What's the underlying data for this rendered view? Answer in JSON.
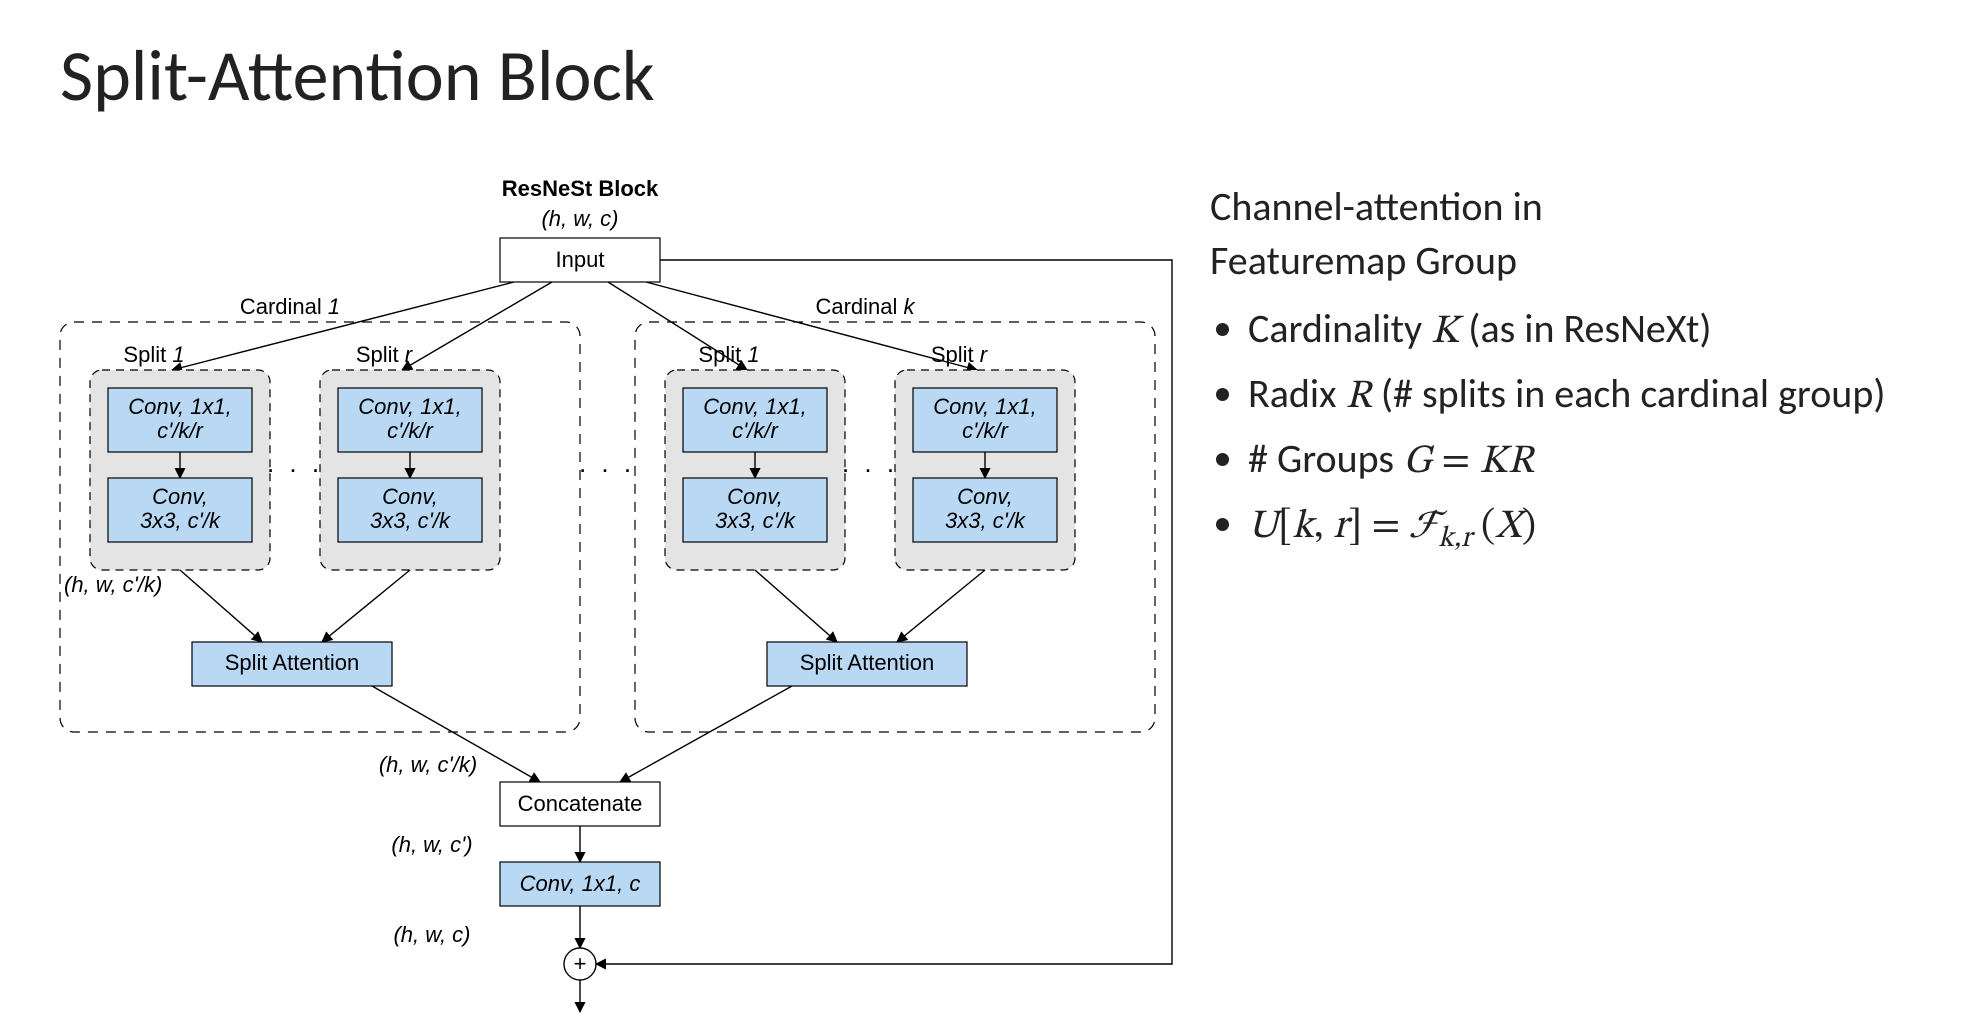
{
  "title": "Split-Attention Block",
  "right": {
    "subhead1": "Channel-attention in",
    "subhead2": "Featuremap Group",
    "b1_pre": "Cardinality ",
    "b1_var": "K",
    "b1_post": " (as in ResNeXt)",
    "b2_pre": "Radix ",
    "b2_var": "R",
    "b2_post": " (# splits in each cardinal group)",
    "b3_pre": "# Groups ",
    "b3_varG": "G",
    "b3_eq": " = ",
    "b3_varK": "K",
    "b3_varR": "R",
    "b4_varU": "U",
    "b4_lb1": "[",
    "b4_k": "k",
    "b4_comma": ", ",
    "b4_r": "r",
    "b4_rb1": "]",
    "b4_eq": " = ",
    "b4_F": "ℱ",
    "b4_subk": "k",
    "b4_subcomma": ",",
    "b4_subr": "r",
    "b4_sp": " ",
    "b4_lp": "(",
    "b4_X": "X",
    "b4_rp": ")"
  },
  "diagram": {
    "resnest_title": "ResNeSt Block",
    "hwc": "(h, w, c)",
    "input": "Input",
    "cardinal1": "Cardinal 1",
    "cardinalk": "Cardinal k",
    "split1": "Split 1",
    "splitr": "Split r",
    "conv11_l1": "Conv, 1x1,",
    "conv11_l2": "c'/k/r",
    "conv33_l1": "Conv,",
    "conv33_l2": "3x3, c'/k",
    "split_attn": "Split Attention",
    "hwc_k": "(h, w, c'/k)",
    "hwc_k2": "(h, w, c'/k)",
    "concat": "Concatenate",
    "hwc_prime": "(h, w, c')",
    "conv11c": "Conv, 1x1, c",
    "hwc2": "(h, w, c)",
    "dots": ". . .",
    "plus": "+"
  }
}
